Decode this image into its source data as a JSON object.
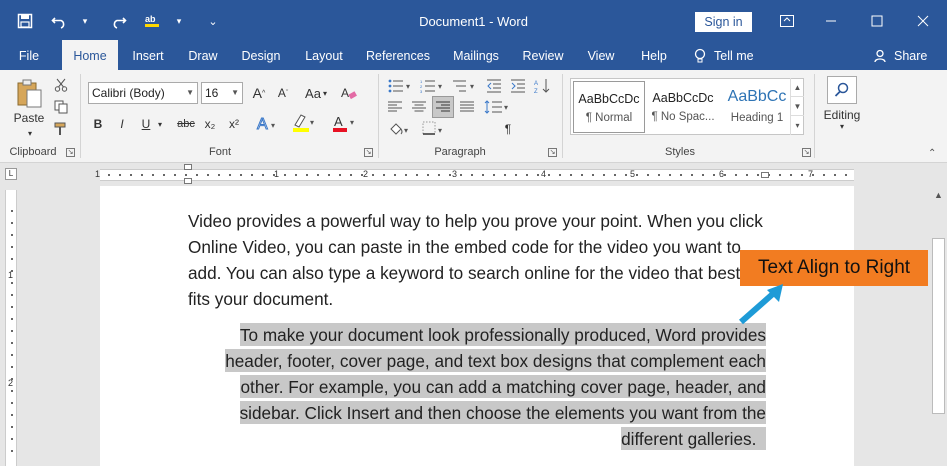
{
  "titlebar": {
    "doc_title": "Document1 - Word",
    "signin": "Sign in",
    "icons": [
      "save-icon",
      "undo-icon",
      "redo-icon",
      "spelling-icon",
      "customize-qat-icon"
    ]
  },
  "tabs": [
    "File",
    "Home",
    "Insert",
    "Draw",
    "Design",
    "Layout",
    "References",
    "Mailings",
    "Review",
    "View",
    "Help"
  ],
  "active_tab": "Home",
  "tell_me": "Tell me",
  "share": "Share",
  "ribbon": {
    "clipboard": {
      "label": "Clipboard",
      "paste": "Paste"
    },
    "font": {
      "label": "Font",
      "font_name": "Calibri (Body)",
      "font_size": "16",
      "bold": "B",
      "italic": "I",
      "underline": "U",
      "strike": "abc",
      "subscript": "x₂",
      "superscript": "x²",
      "grow": "A",
      "shrink": "A",
      "case": "Aa"
    },
    "paragraph": {
      "label": "Paragraph"
    },
    "styles": {
      "label": "Styles",
      "items": [
        {
          "preview": "AaBbCcDc",
          "name": "¶ Normal"
        },
        {
          "preview": "AaBbCcDc",
          "name": "¶ No Spac..."
        },
        {
          "preview": "AaBbCc",
          "name": "Heading 1"
        }
      ]
    },
    "editing": {
      "label": "Editing"
    }
  },
  "ruler_numbers": [
    "1",
    "1",
    "2",
    "3",
    "4",
    "5",
    "6",
    "7"
  ],
  "vruler_numbers": [
    "1",
    "2"
  ],
  "document": {
    "para1": "Video provides a powerful way to help you prove your point. When you click Online Video, you can paste in the embed code for the video you want to add. You can also type a keyword to search online for the video that best fits your document.",
    "para2_lines": [
      "To make your document look professionally produced, Word provides",
      "header, footer, cover page, and text box designs that complement each",
      "other. For example, you can add a matching cover page, header, and",
      "sidebar. Click Insert and then choose the elements you want from the",
      "different galleries."
    ]
  },
  "callout": {
    "text": "Text Align to Right",
    "color": "#f27c21"
  },
  "colors": {
    "brand": "#2b579a",
    "ribbon": "#f3f3f3",
    "selection": "#c8c8c8"
  }
}
